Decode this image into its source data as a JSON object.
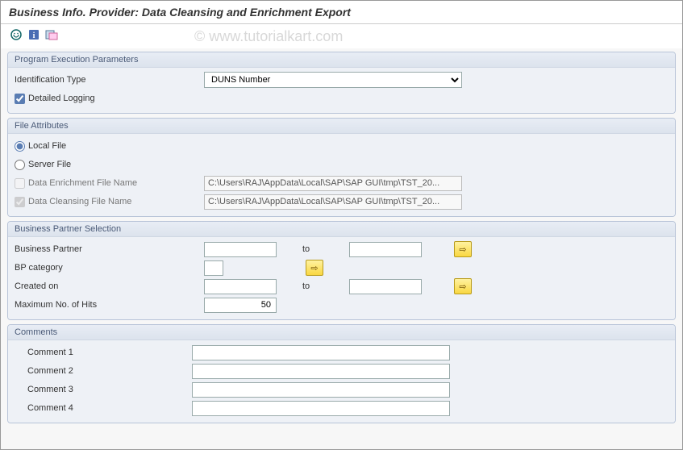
{
  "title": "Business Info. Provider: Data Cleansing and Enrichment Export",
  "watermark": "© www.tutorialkart.com",
  "groups": {
    "exec": {
      "title": "Program Execution Parameters",
      "id_type_label": "Identification Type",
      "id_type_value": "DUNS Number",
      "detailed_logging_label": "Detailed Logging"
    },
    "file": {
      "title": "File Attributes",
      "local_label": "Local File",
      "server_label": "Server File",
      "enrich_label": "Data Enrichment File Name",
      "enrich_value": "C:\\Users\\RAJ\\AppData\\Local\\SAP\\SAP GUI\\tmp\\TST_20...",
      "cleanse_label": "Data Cleansing File Name",
      "cleanse_value": "C:\\Users\\RAJ\\AppData\\Local\\SAP\\SAP GUI\\tmp\\TST_20..."
    },
    "bp": {
      "title": "Business Partner Selection",
      "bp_label": "Business Partner",
      "cat_label": "BP category",
      "created_label": "Created on",
      "maxhits_label": "Maximum No. of Hits",
      "maxhits_value": "50",
      "to": "to"
    },
    "comments": {
      "title": "Comments",
      "c1": "Comment 1",
      "c2": "Comment 2",
      "c3": "Comment 3",
      "c4": "Comment 4"
    }
  },
  "icons": {
    "arrow": "⇨"
  }
}
